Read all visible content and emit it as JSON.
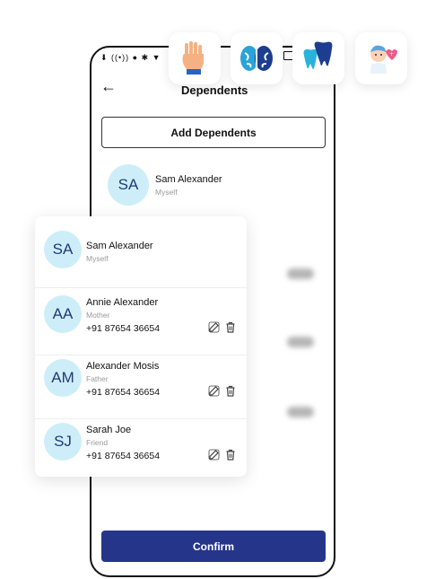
{
  "header": {
    "title": "Dependents"
  },
  "status_bar": {
    "icons": "⬇ ((•)) ● ✱ ▼"
  },
  "actions": {
    "add_label": "Add Dependents",
    "confirm_label": "Confirm"
  },
  "self_entry": {
    "initials": "SA",
    "name": "Sam Alexander",
    "relation": "Myself"
  },
  "dependents": [
    {
      "initials": "SA",
      "name": "Sam Alexander",
      "relation": "Myself",
      "phone": ""
    },
    {
      "initials": "AA",
      "name": "Annie Alexander",
      "relation": "Mother",
      "phone": "+91 87654 36654"
    },
    {
      "initials": "AM",
      "name": "Alexander Mosis",
      "relation": "Father",
      "phone": "+91 87654 36654"
    },
    {
      "initials": "SJ",
      "name": "Sarah Joe",
      "relation": "Friend",
      "phone": "+91 87654 36654"
    }
  ],
  "floating_icons": [
    "hand-icon",
    "brain-icon",
    "tooth-icon",
    "baby-icon"
  ],
  "colors": {
    "primary": "#25368a",
    "avatar_bg": "#cdeef8",
    "avatar_text": "#1c3a78"
  }
}
